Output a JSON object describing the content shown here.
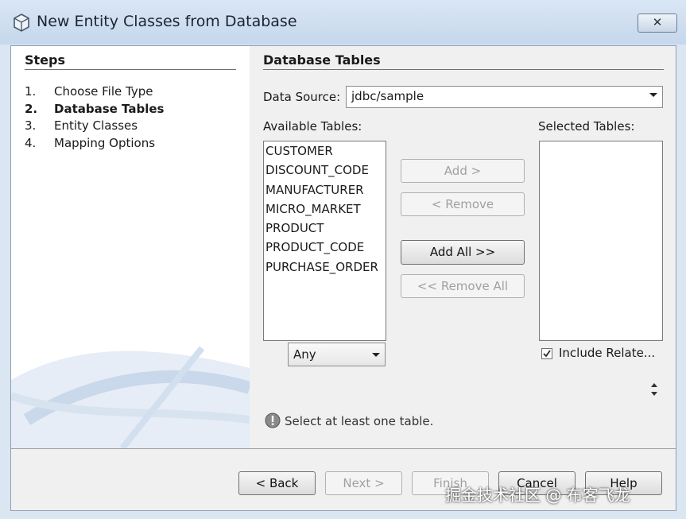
{
  "window": {
    "title": "New Entity Classes from Database",
    "close_label": "✕"
  },
  "steps": {
    "title": "Steps",
    "items": [
      {
        "num": "1.",
        "label": "Choose File Type"
      },
      {
        "num": "2.",
        "label": "Database Tables"
      },
      {
        "num": "3.",
        "label": "Entity Classes"
      },
      {
        "num": "4.",
        "label": "Mapping Options"
      }
    ],
    "active_index": 1
  },
  "panel": {
    "title": "Database Tables",
    "data_source": {
      "label": "Data Source:",
      "value": "jdbc/sample"
    },
    "available": {
      "label": "Available Tables:",
      "items": [
        "CUSTOMER",
        "DISCOUNT_CODE",
        "MANUFACTURER",
        "MICRO_MARKET",
        "PRODUCT",
        "PRODUCT_CODE",
        "PURCHASE_ORDER"
      ],
      "filter_value": "Any"
    },
    "selected": {
      "label": "Selected Tables:",
      "items": [],
      "include_related_label": "Include Relate...",
      "include_related_checked": true
    },
    "buttons": {
      "add": "Add >",
      "remove": "< Remove",
      "add_all": "Add All >>",
      "remove_all": "<< Remove All"
    },
    "message": "Select at least one table."
  },
  "footer": {
    "back": "< Back",
    "next": "Next >",
    "finish": "Finish",
    "cancel": "Cancel",
    "help": "Help"
  },
  "watermark": "掘金技术社区 @ 布客飞龙"
}
